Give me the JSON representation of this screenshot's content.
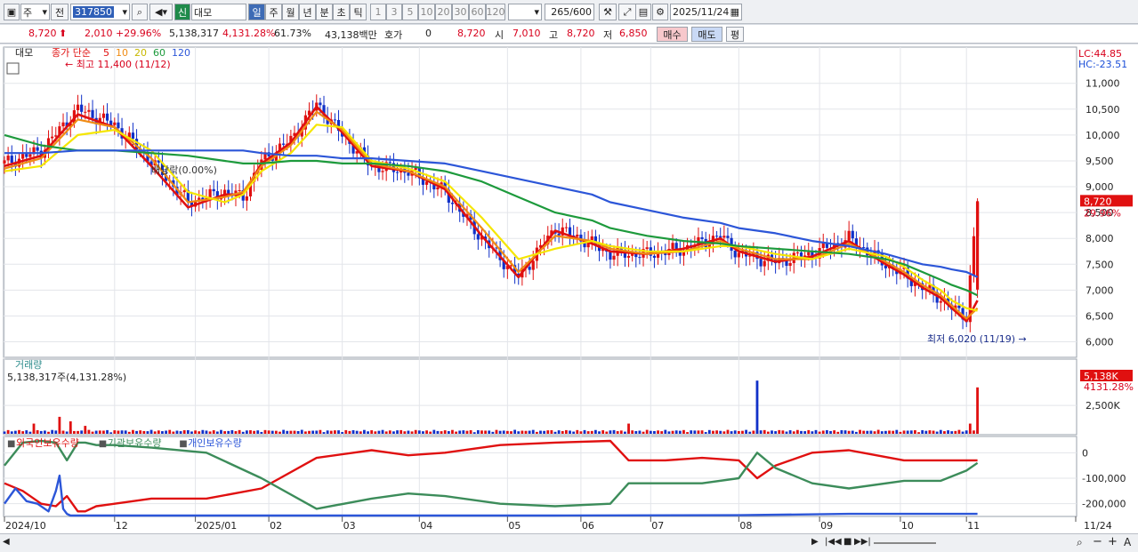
{
  "toolbar": {
    "market": "주",
    "prev_label": "전",
    "code": "317850",
    "badge": "신",
    "name": "대모",
    "periods": [
      "일",
      "주",
      "월",
      "년",
      "분",
      "초",
      "틱"
    ],
    "active_period": "일",
    "intervals": [
      "1",
      "3",
      "5",
      "10",
      "20",
      "30",
      "60",
      "120"
    ],
    "count": "265",
    "count_max": "/600",
    "date": "2025/11/24"
  },
  "info": {
    "price": "8,720",
    "change": "2,010",
    "change_pct": "+29.96%",
    "volume": "5,138,317",
    "volume_pct": "4,131.28%",
    "turnover": "61.73%",
    "amount": "43,138백만",
    "quote_label": "호가",
    "quote": "0",
    "quote_price": "8,720",
    "open_label": "시",
    "open": "7,010",
    "high_label": "고",
    "high": "8,720",
    "low_label": "저",
    "low": "6,850",
    "buy": "매수",
    "sell": "매도",
    "avg": "평"
  },
  "chart_data": [
    {
      "type": "line",
      "title": "대모",
      "legend": {
        "label": "종가 단순",
        "periods": [
          "5",
          "10",
          "20",
          "60",
          "120"
        ]
      },
      "colors": {
        "ma5": "#e01010",
        "ma10": "#f08c14",
        "ma20": "#f5e600",
        "ma60": "#1d9a3c",
        "ma120": "#2c56d8",
        "up": "#e01010",
        "down": "#1030c8"
      },
      "ylim": [
        5700,
        11700
      ],
      "y_ticks": [
        "11,000",
        "10,500",
        "10,000",
        "9,500",
        "9,000",
        "8,500",
        "8,000",
        "7,500",
        "7,000",
        "6,500",
        "6,000"
      ],
      "y_tick_values": [
        11000,
        10500,
        10000,
        9500,
        9000,
        8500,
        8000,
        7500,
        7000,
        6500,
        6000
      ],
      "lc": "LC:44.85",
      "hc": "HC:-23.51",
      "last_price_label": "8,720",
      "last_pct_label": "29.96%",
      "annotations": {
        "high": "최고 11,400 (11/12)",
        "low": "최저 6,020 (11/19)",
        "dividend": "배당락(0.00%)"
      },
      "series_close": [
        {
          "name": "price",
          "x": [
            0,
            10,
            20,
            30,
            40,
            50,
            60,
            65,
            70,
            78,
            85,
            92,
            100,
            110,
            120,
            130,
            140,
            150,
            160,
            165,
            175,
            185,
            195,
            200,
            210,
            220,
            230,
            240,
            245,
            250,
            255,
            258,
            262,
            265
          ],
          "values": [
            9450,
            9700,
            10500,
            10200,
            9500,
            8700,
            8900,
            8800,
            9500,
            9900,
            10600,
            10000,
            9400,
            9300,
            8900,
            8000,
            7250,
            8200,
            7900,
            7700,
            7700,
            7800,
            8050,
            7700,
            7550,
            7700,
            8000,
            7500,
            7300,
            7050,
            6850,
            6650,
            6500,
            8720
          ]
        },
        {
          "name": "ma5",
          "values": [
            9400,
            9600,
            10400,
            10150,
            9400,
            8600,
            8850,
            8850,
            9450,
            9850,
            10550,
            10050,
            9400,
            9300,
            8950,
            8050,
            7250,
            8150,
            7900,
            7750,
            7700,
            7800,
            8000,
            7750,
            7550,
            7650,
            7950,
            7500,
            7300,
            7050,
            6850,
            6650,
            6400,
            6800
          ]
        },
        {
          "name": "ma10",
          "values": [
            9350,
            9550,
            10300,
            10150,
            9550,
            8700,
            8800,
            8900,
            9400,
            9800,
            10450,
            10100,
            9450,
            9300,
            9000,
            8200,
            7350,
            8050,
            7950,
            7800,
            7700,
            7750,
            7950,
            7800,
            7600,
            7600,
            7900,
            7550,
            7350,
            7100,
            6900,
            6700,
            6450,
            6650
          ]
        },
        {
          "name": "ma20",
          "values": [
            9300,
            9400,
            10000,
            10100,
            9700,
            8900,
            8700,
            8850,
            9300,
            9650,
            10200,
            10150,
            9500,
            9350,
            9100,
            8400,
            7600,
            7800,
            7950,
            7850,
            7750,
            7750,
            7850,
            7850,
            7700,
            7600,
            7800,
            7650,
            7450,
            7200,
            7000,
            6800,
            6650,
            6600
          ]
        },
        {
          "name": "ma60",
          "values": [
            10000,
            9800,
            9700,
            9700,
            9650,
            9600,
            9500,
            9450,
            9450,
            9500,
            9500,
            9450,
            9450,
            9400,
            9300,
            9100,
            8800,
            8500,
            8350,
            8200,
            8050,
            7950,
            7900,
            7850,
            7800,
            7750,
            7700,
            7600,
            7500,
            7350,
            7200,
            7100,
            7000,
            6900
          ]
        },
        {
          "name": "ma120",
          "values": [
            9650,
            9650,
            9700,
            9700,
            9700,
            9700,
            9700,
            9700,
            9650,
            9600,
            9600,
            9550,
            9550,
            9500,
            9450,
            9300,
            9150,
            9000,
            8850,
            8700,
            8550,
            8400,
            8300,
            8200,
            8100,
            7950,
            7850,
            7700,
            7600,
            7500,
            7450,
            7400,
            7350,
            7250
          ]
        }
      ]
    },
    {
      "type": "bar",
      "title": "거래량",
      "value_label": "5,138,317주(4,131.28%)",
      "y_ticks": [
        "2,500K"
      ],
      "y_tick_values": [
        2500
      ],
      "ylim": [
        0,
        5500
      ],
      "last_label": "5,138K",
      "last_pct_label": "4131.28%",
      "unit": "K",
      "spikes": [
        {
          "x": 8,
          "value": 900,
          "dir": "up"
        },
        {
          "x": 15,
          "value": 1500,
          "dir": "up"
        },
        {
          "x": 18,
          "value": 1100,
          "dir": "up"
        },
        {
          "x": 22,
          "value": 700,
          "dir": "up"
        },
        {
          "x": 170,
          "value": 900,
          "dir": "up"
        },
        {
          "x": 205,
          "value": 4700,
          "dir": "down"
        },
        {
          "x": 263,
          "value": 900,
          "dir": "up"
        },
        {
          "x": 265,
          "value": 4100,
          "dir": "up"
        }
      ],
      "baseline": 120
    },
    {
      "type": "line",
      "legend": [
        "외국인보유수량",
        "기관보유수량",
        "개인보유수량"
      ],
      "colors": [
        "#e01010",
        "#3c8c5a",
        "#2c56d8"
      ],
      "y_ticks": [
        "0",
        "-100,000",
        "-200,000"
      ],
      "y_tick_values": [
        0,
        -100000,
        -200000
      ],
      "ylim": [
        -250000,
        50000
      ],
      "series": [
        {
          "name": "외국인보유수량",
          "x": [
            0,
            5,
            10,
            14,
            17,
            20,
            22,
            25,
            30,
            40,
            55,
            70,
            85,
            100,
            110,
            120,
            135,
            150,
            165,
            170,
            180,
            190,
            200,
            205,
            210,
            220,
            230,
            245,
            255,
            262,
            265
          ],
          "values": [
            -120000,
            -150000,
            -200000,
            -210000,
            -170000,
            -230000,
            -230000,
            -210000,
            -200000,
            -180000,
            -180000,
            -140000,
            -20000,
            10000,
            -10000,
            0,
            30000,
            40000,
            50000,
            -30000,
            -30000,
            -20000,
            -30000,
            -100000,
            -50000,
            0,
            10000,
            -30000,
            -30000,
            -30000,
            -30000
          ]
        },
        {
          "name": "기관보유수량",
          "x": [
            0,
            5,
            10,
            14,
            17,
            20,
            22,
            25,
            30,
            40,
            55,
            70,
            85,
            100,
            110,
            120,
            135,
            150,
            165,
            170,
            180,
            190,
            200,
            205,
            210,
            220,
            230,
            245,
            255,
            262,
            265
          ],
          "values": [
            -50000,
            40000,
            50000,
            40000,
            -30000,
            40000,
            40000,
            30000,
            30000,
            20000,
            0,
            -100000,
            -220000,
            -180000,
            -160000,
            -170000,
            -200000,
            -210000,
            -200000,
            -120000,
            -120000,
            -120000,
            -100000,
            0,
            -60000,
            -120000,
            -140000,
            -110000,
            -110000,
            -70000,
            -40000
          ]
        },
        {
          "name": "개인보유수량",
          "x": [
            0,
            3,
            6,
            9,
            12,
            14,
            15,
            16,
            17,
            18,
            20,
            25,
            60,
            100,
            150,
            200,
            230,
            265
          ],
          "values": [
            -200000,
            -140000,
            -190000,
            -200000,
            -230000,
            -150000,
            -90000,
            -220000,
            -240000,
            -250000,
            -250000,
            -250000,
            -250000,
            -250000,
            -250000,
            -245000,
            -240000,
            -240000
          ]
        }
      ]
    }
  ],
  "x_axis": {
    "labels": [
      "2024/10",
      "12",
      "2025/01",
      "02",
      "03",
      "04",
      "05",
      "06",
      "07",
      "08",
      "09",
      "10",
      "11",
      "11/24"
    ],
    "positions": [
      0,
      30,
      52,
      72,
      92,
      113,
      137,
      157,
      176,
      200,
      222,
      244,
      262,
      292
    ],
    "xmax": 292
  }
}
